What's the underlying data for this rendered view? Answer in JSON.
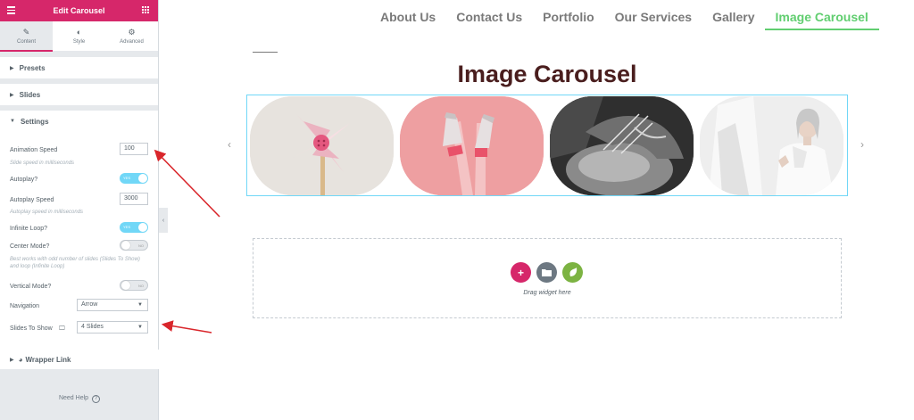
{
  "panel": {
    "header_title": "Edit Carousel",
    "tabs": [
      {
        "label": "Content",
        "icon": "pencil-icon"
      },
      {
        "label": "Style",
        "icon": "half-circle-icon"
      },
      {
        "label": "Advanced",
        "icon": "gear-icon"
      }
    ],
    "sections": {
      "presets": "Presets",
      "slides": "Slides",
      "settings": "Settings",
      "wrapper_link": "Wrapper Link"
    },
    "settings": {
      "animation_speed_label": "Animation Speed",
      "animation_speed_value": "100",
      "animation_speed_hint": "Slide speed in milliseconds",
      "autoplay_label": "Autoplay?",
      "autoplay_state": "YES",
      "autoplay_speed_label": "Autoplay Speed",
      "autoplay_speed_value": "3000",
      "autoplay_speed_hint": "Autoplay speed in milliseconds",
      "infinite_loop_label": "Infinite Loop?",
      "infinite_loop_state": "YES",
      "center_mode_label": "Center Mode?",
      "center_mode_state": "NO",
      "center_mode_hint": "Best works with odd number of slides (Slides To Show) and loop (Infinite Loop)",
      "vertical_mode_label": "Vertical Mode?",
      "vertical_mode_state": "NO",
      "navigation_label": "Navigation",
      "navigation_value": "Arrow",
      "slides_to_show_label": "Slides To Show",
      "slides_to_show_value": "4 Slides"
    },
    "need_help": "Need Help",
    "accent_color": "#d6276a"
  },
  "nav": {
    "items": [
      "About Us",
      "Contact Us",
      "Portfolio",
      "Our Services",
      "Gallery",
      "Image Carousel"
    ],
    "active": "Image Carousel",
    "active_color": "#61ce70"
  },
  "carousel": {
    "title": "Image Carousel",
    "slides": [
      "pinwheel",
      "sneakers-legs",
      "hands-tying-shoe",
      "woman-white-shirt"
    ],
    "prev_icon": "chevron-left-icon",
    "next_icon": "chevron-right-icon"
  },
  "dropzone": {
    "text": "Drag widget here",
    "buttons": [
      {
        "icon": "plus-icon",
        "color": "#d6276a"
      },
      {
        "icon": "folder-icon",
        "color": "#6d7882"
      },
      {
        "icon": "leaf-icon",
        "color": "#7cb342"
      }
    ]
  }
}
